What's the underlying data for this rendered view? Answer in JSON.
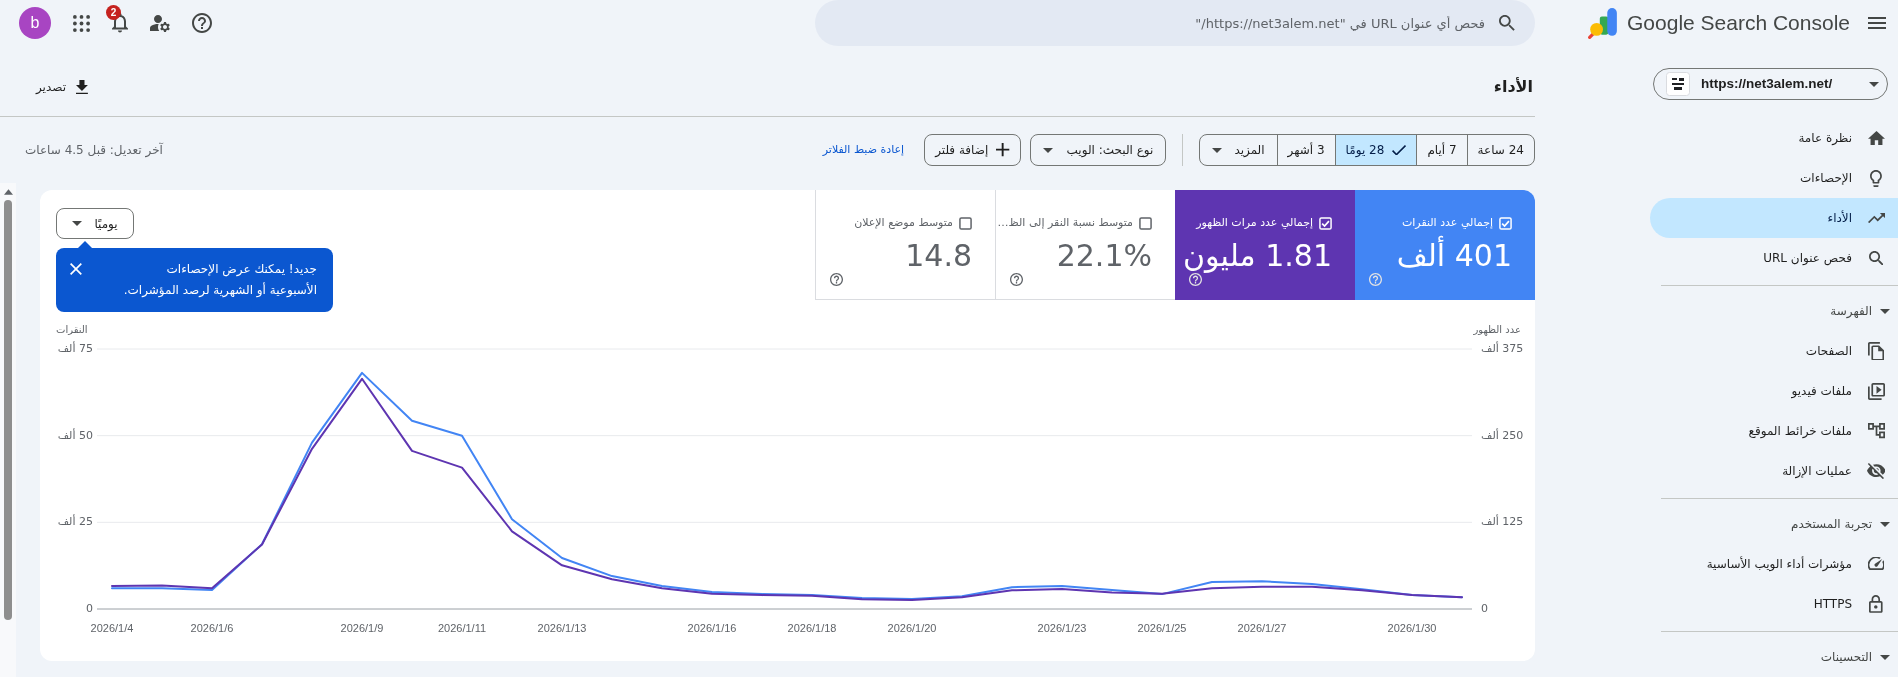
{
  "top_bar": {
    "product_name": "Google Search Console",
    "search": {
      "placeholder": "فحص أي عنوان URL في \"https://net3alem.net/\""
    },
    "notifications": {
      "badge": "2"
    },
    "avatar": {
      "letter": "b"
    }
  },
  "sidebar": {
    "property": {
      "url": "https://net3alem.net/"
    },
    "items": [
      {
        "label": "نظرة عامة",
        "selected": false
      },
      {
        "label": "الإحصاءات",
        "selected": false
      },
      {
        "label": "الأداء",
        "selected": true
      },
      {
        "label": "فحص عنوان URL",
        "selected": false
      }
    ],
    "sections": [
      {
        "label": "الفهرسة",
        "expanded": true,
        "items": [
          {
            "label": "الصفحات",
            "selected": false
          },
          {
            "label": "ملفات فيديو",
            "selected": false
          },
          {
            "label": "ملفات خرائط الموقع",
            "selected": false
          },
          {
            "label": "عمليات الإزالة",
            "selected": false
          }
        ]
      },
      {
        "label": "تجربة المستخدم",
        "expanded": true,
        "items": [
          {
            "label": "مؤشرات أداء الويب الأساسية",
            "selected": false
          },
          {
            "label": "HTTPS",
            "selected": false
          }
        ]
      },
      {
        "label": "التحسينات",
        "expanded": true
      }
    ]
  },
  "page": {
    "title": "الأداء",
    "export": "تصدير"
  },
  "filters": {
    "date_ranges": [
      {
        "label": "24 ساعة",
        "selected": false
      },
      {
        "label": "7 أيام",
        "selected": false
      },
      {
        "label": "28 يومًا",
        "selected": true
      },
      {
        "label": "3 أشهر",
        "selected": false
      }
    ],
    "more": "المزيد",
    "search_type": "نوع البحث: الويب",
    "add_filter": "إضافة فلتر",
    "reset": "إعادة ضبط الفلاتر",
    "last_updated": "آخر تعديل: قبل 4.5 ساعات"
  },
  "card": {
    "granularity": "يوميًا",
    "tooltip": "جديد! يمكنك عرض الإحصاءات الأسبوعية أو الشهرية لرصد المؤشرات.",
    "metrics": [
      {
        "label": "إجمالي عدد النقرات",
        "value": "401 ألف",
        "checked": true,
        "color": "#4285f4"
      },
      {
        "label": "إجمالي عدد مرات الظهور",
        "value": "1.81 مليون",
        "checked": true,
        "color": "#5e35b1"
      },
      {
        "label": "متوسط نسبة النقر إلى الظ…",
        "value": "22.1%",
        "checked": false
      },
      {
        "label": "متوسط موضع الإعلان",
        "value": "14.8",
        "checked": false
      }
    ],
    "chart_data": {
      "type": "line",
      "categories": [
        "2026/1/4",
        null,
        "2026/1/6",
        null,
        null,
        "2026/1/9",
        null,
        "2026/1/11",
        null,
        "2026/1/13",
        null,
        null,
        "2026/1/16",
        null,
        "2026/1/18",
        null,
        "2026/1/20",
        null,
        null,
        "2026/1/23",
        null,
        "2026/1/25",
        null,
        "2026/1/27",
        null,
        null,
        "2026/1/30",
        null
      ],
      "ylabel": "النقرات",
      "ylim": [
        0,
        75
      ],
      "yticks": [
        0,
        {
          "value": 25,
          "label": "25 ألف"
        },
        {
          "value": 50,
          "label": "50 ألف"
        },
        {
          "value": 75,
          "label": "75 ألف"
        }
      ],
      "y2label": "عدد الظهور",
      "y2lim": [
        0,
        375
      ],
      "y2ticks": [
        0,
        {
          "value": 125,
          "label": "125 ألف"
        },
        {
          "value": 250,
          "label": "250 ألف"
        },
        {
          "value": 375,
          "label": "375 ألف"
        }
      ],
      "series": [
        {
          "color": "#4285f4",
          "values": [
            6,
            6,
            5.5,
            18.7,
            48,
            68.1,
            54.3,
            50,
            25.9,
            14.7,
            9.5,
            6.6,
            4.9,
            4.3,
            4,
            3.2,
            2.9,
            3.7,
            6.3,
            6.6,
            5.5,
            4.3,
            7.8,
            8,
            7.2,
            5.7,
            4,
            3.4
          ]
        },
        {
          "axis": "y2",
          "color": "#5e35b1",
          "values": [
            33,
            34,
            30,
            93,
            231,
            332,
            228,
            204,
            112,
            63,
            43,
            30,
            22,
            20,
            19,
            14,
            13,
            17,
            27,
            29,
            24,
            22,
            30,
            32,
            32,
            27,
            20,
            17
          ]
        }
      ]
    }
  }
}
